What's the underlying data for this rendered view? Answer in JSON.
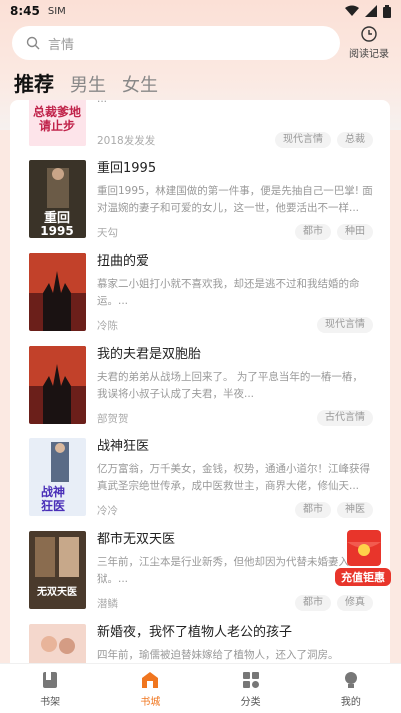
{
  "status": {
    "time": "8:45",
    "sim": "SIM"
  },
  "search": {
    "placeholder": "言情"
  },
  "history": {
    "label": "阅读记录"
  },
  "tabs": [
    {
      "label": "推荐"
    },
    {
      "label": "男生"
    },
    {
      "label": "女生"
    }
  ],
  "books": [
    {
      "title": "",
      "desc": "...",
      "author": "2018发发发",
      "tags": [
        "现代言情",
        "总裁"
      ],
      "cover_text": "总裁爹地请止步"
    },
    {
      "title": "重回1995",
      "desc": "重回1995，林建国做的第一件事，便是先抽自己一巴掌! 面对温婉的妻子和可爱的女儿，这一世，他要活出不一样...",
      "author": "天勾",
      "tags": [
        "都市",
        "种田"
      ],
      "cover_text": "重回1995"
    },
    {
      "title": "扭曲的爱",
      "desc": "慕家二小姐打小就不喜欢我，却还是逃不过和我结婚的命运。...",
      "author": "冷陈",
      "tags": [
        "现代言情"
      ],
      "cover_text": ""
    },
    {
      "title": "我的夫君是双胞胎",
      "desc": "夫君的弟弟从战场上回来了。 为了平息当年的一樁一樁，我误将小叔子认成了夫君，半夜...",
      "author": "部贺贺",
      "tags": [
        "古代言情"
      ],
      "cover_text": ""
    },
    {
      "title": "战神狂医",
      "desc": "亿万富翁，万千美女，金钱，权势，通通小道尔！江峰获得真武圣宗绝世传承，成中医救世主，商界大佬，修仙天...",
      "author": "冷冷",
      "tags": [
        "都市",
        "神医"
      ],
      "cover_text": "战神狂医"
    },
    {
      "title": "都市无双天医",
      "desc": "三年前，江尘本是行业新秀，但他却因为代替未婚妻入狱。...",
      "author": "潜鳞",
      "tags": [
        "都市",
        "修真"
      ],
      "cover_text": "都市无双天医"
    },
    {
      "title": "新婚夜，我怀了植物人老公的孩子",
      "desc": "四年前，瑜儒被迫替妹嫁给了植物人，还入了洞房。",
      "author": "",
      "tags": [],
      "cover_text": ""
    }
  ],
  "promo": {
    "label": "充值钜惠"
  },
  "tabbar": [
    {
      "label": "书架",
      "icon": "bookshelf-icon"
    },
    {
      "label": "书城",
      "icon": "store-icon"
    },
    {
      "label": "分类",
      "icon": "category-icon"
    },
    {
      "label": "我的",
      "icon": "profile-icon"
    }
  ],
  "colors": {
    "accent": "#f0761f",
    "background": "#fbe9e2"
  }
}
